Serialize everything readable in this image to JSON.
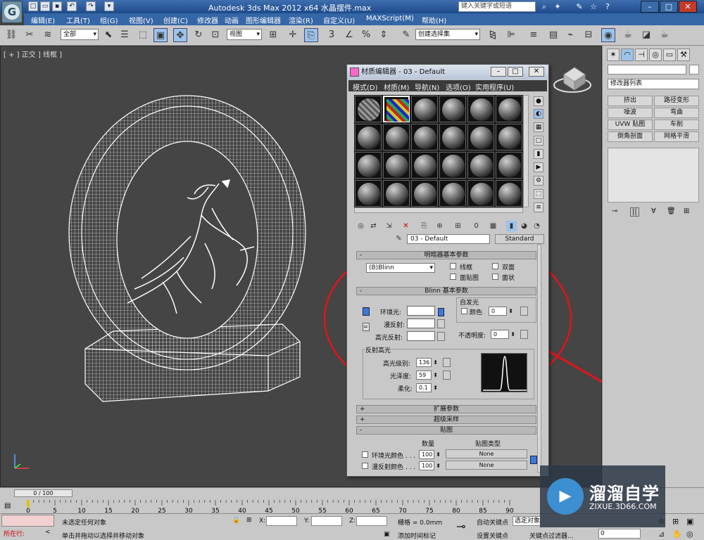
{
  "title_bar": {
    "app_title": "Autodesk 3ds Max  2012 x64    水晶摆件.max",
    "search_placeholder": "键入关键字或短语",
    "quick_access": [
      "new-icon",
      "open-icon",
      "save-icon",
      "undo-icon",
      "redo-icon",
      "dropdown-icon"
    ]
  },
  "menu": [
    "编辑(E)",
    "工具(T)",
    "组(G)",
    "视图(V)",
    "创建(C)",
    "修改器",
    "动画",
    "图形编辑器",
    "渲染(R)",
    "自定义(U)",
    "MAXScript(M)",
    "帮助(H)"
  ],
  "toolbar": {
    "selection_filter": "全部",
    "reference_coord": "视图",
    "named_selection": "创建选择集"
  },
  "viewport": {
    "label": "[ + ] 正交 ] 线框 ]"
  },
  "command_panel": {
    "modifier_list": "修改器列表",
    "buttons": [
      "挤出",
      "路径变形",
      "噪波",
      "弯曲",
      "UVW 贴图",
      "车削",
      "倒角剖面",
      "网格平滑"
    ]
  },
  "material_editor": {
    "title": "材质编辑器 - 03 - Default",
    "menu": [
      "模式(D)",
      "材质(M)",
      "导航(N)",
      "选项(O)",
      "实用程序(U)"
    ],
    "material_name": "03 - Default",
    "material_type": "Standard",
    "shader_rollout": "明暗器基本参数",
    "shader_type": "(B)Blinn",
    "shader_opts": [
      "线框",
      "双面",
      "面贴图",
      "面状"
    ],
    "blinn_rollout": "Blinn 基本参数",
    "self_illum_group": "自发光",
    "self_illum_color_label": "颜色",
    "self_illum_value": "0",
    "ambient_label": "环境光:",
    "diffuse_label": "漫反射:",
    "specular_label": "高光反射:",
    "opacity_label": "不透明度:",
    "opacity_value": "0",
    "spec_group": "反射高光",
    "spec_level_label": "高光级别:",
    "spec_level": "136",
    "glossiness_label": "光泽度:",
    "glossiness": "59",
    "soften_label": "柔化:",
    "soften": "0.1",
    "rollouts": [
      {
        "sign": "+",
        "label": "扩展参数"
      },
      {
        "sign": "+",
        "label": "超级采样"
      },
      {
        "sign": "-",
        "label": "贴图"
      }
    ],
    "maps_header": {
      "amount": "数量",
      "type": "贴图类型"
    },
    "maps": [
      {
        "label": "环境光颜色 . . .",
        "amount": "100",
        "map": "None"
      },
      {
        "label": "漫反射颜色 . . .",
        "amount": "100",
        "map": "None"
      }
    ]
  },
  "trackbar": {
    "time_slider": "0 / 100",
    "ticks": [
      "0",
      "5",
      "10",
      "15",
      "20",
      "25",
      "30",
      "35",
      "40",
      "45",
      "50",
      "55",
      "60",
      "65",
      "70",
      "75",
      "80",
      "85",
      "90"
    ]
  },
  "status_bar": {
    "script_label": "所在行:",
    "selection_status": "未选定任何对象",
    "prompt": "单击并拖动以选择并移动对象",
    "x_label": "X:",
    "y_label": "Y:",
    "z_label": "Z:",
    "grid": "栅格 = 0.0mm",
    "add_time_tag": "添加时间标记",
    "auto_key": "自动关键点",
    "selected": "选定对象",
    "set_key": "设置关键点",
    "key_filters": "关键点过滤器...",
    "frame_value": "0"
  },
  "watermark": {
    "brand": "溜溜自学",
    "url": "ZIXUE.3D66.COM"
  },
  "colors": {
    "annotation": "#e0141a",
    "title_bar": "#2a5a9c",
    "viewport_bg": "#454545"
  }
}
